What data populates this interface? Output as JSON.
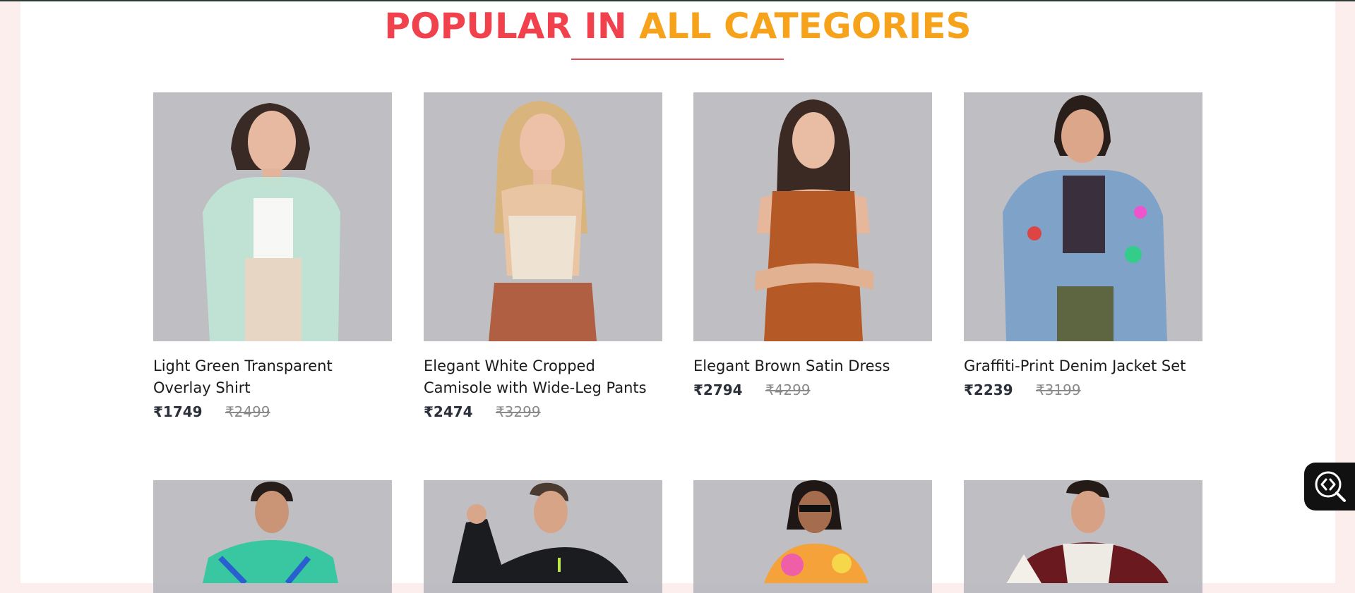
{
  "section": {
    "heading_part_a": "POPULAR IN",
    "heading_part_b": "ALL CATEGORIES"
  },
  "products": [
    {
      "title": "Light Green Transparent Overlay Shirt",
      "price": "₹1749",
      "old_price": "₹2499",
      "icon": "model-photo"
    },
    {
      "title": "Elegant White Cropped Camisole with Wide-Leg Pants",
      "price": "₹2474",
      "old_price": "₹3299",
      "icon": "model-photo"
    },
    {
      "title": "Elegant Brown Satin Dress",
      "price": "₹2794",
      "old_price": "₹4299",
      "icon": "model-photo"
    },
    {
      "title": "Graffiti-Print Denim Jacket Set",
      "price": "₹2239",
      "old_price": "₹3199",
      "icon": "model-photo"
    }
  ],
  "products_row2": [
    {
      "icon": "model-photo"
    },
    {
      "icon": "model-photo"
    },
    {
      "icon": "model-photo"
    },
    {
      "icon": "model-photo"
    }
  ],
  "widget": {
    "icon": "code-search-icon"
  },
  "colors": {
    "heading_red": "#f0414d",
    "heading_orange": "#f7a21b",
    "underline": "#e8474f",
    "page_bg": "#fdeeee"
  }
}
